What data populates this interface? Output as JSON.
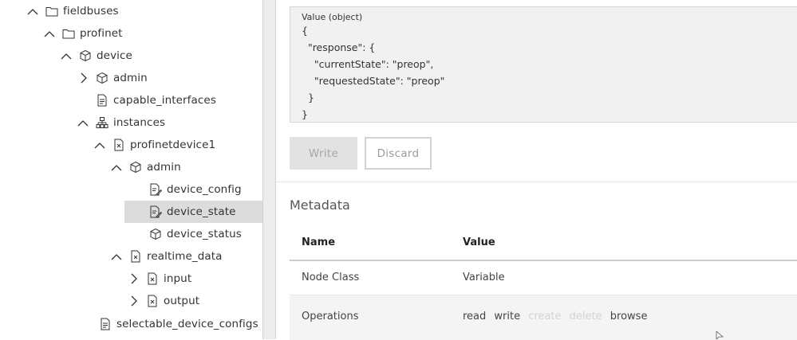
{
  "tree": {
    "items": [
      {
        "label": "fieldbuses"
      },
      {
        "label": "profinet"
      },
      {
        "label": "device"
      },
      {
        "label": "admin"
      },
      {
        "label": "capable_interfaces"
      },
      {
        "label": "instances"
      },
      {
        "label": "profinetdevice1"
      },
      {
        "label": "admin"
      },
      {
        "label": "device_config"
      },
      {
        "label": "device_state"
      },
      {
        "label": "device_status"
      },
      {
        "label": "realtime_data"
      },
      {
        "label": "input"
      },
      {
        "label": "output"
      },
      {
        "label": "selectable_device_configs"
      }
    ]
  },
  "value_box": {
    "title": "Value (object)",
    "lines": [
      "{",
      "  \"response\": {",
      "    \"currentState\": \"preop\",",
      "    \"requestedState\": \"preop\"",
      "  }",
      "}"
    ]
  },
  "buttons": {
    "write": "Write",
    "discard": "Discard"
  },
  "metadata": {
    "title": "Metadata",
    "headers": {
      "name": "Name",
      "value": "Value"
    },
    "rows": [
      {
        "name": "Node Class",
        "value": "Variable"
      },
      {
        "name": "Operations"
      }
    ],
    "operations": [
      {
        "label": "read",
        "enabled": true
      },
      {
        "label": "write",
        "enabled": true
      },
      {
        "label": "create",
        "enabled": false
      },
      {
        "label": "delete",
        "enabled": false
      },
      {
        "label": "browse",
        "enabled": true
      }
    ]
  }
}
